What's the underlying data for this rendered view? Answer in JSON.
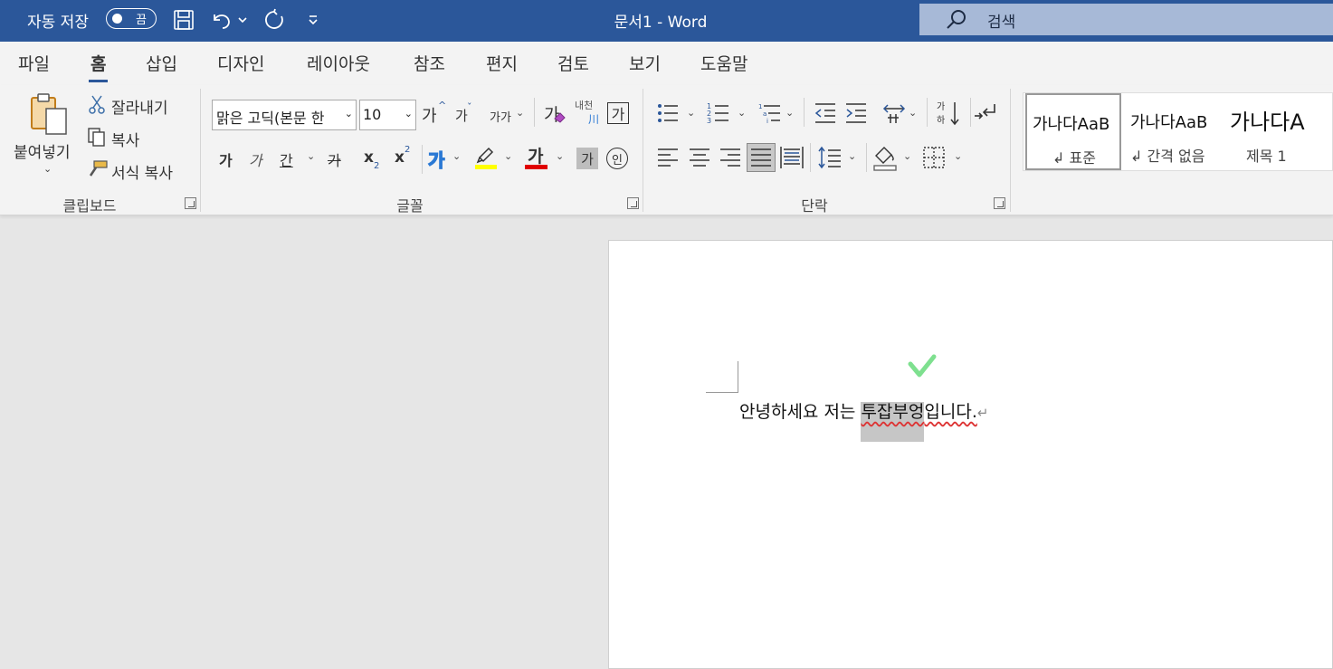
{
  "titlebar": {
    "autosave_label": "자동 저장",
    "autosave_state": "끔",
    "doc_title": "문서1  -  Word",
    "search_placeholder": "검색",
    "bg_color": "#2b579a"
  },
  "tabs": [
    {
      "label": "파일"
    },
    {
      "label": "홈",
      "active": true
    },
    {
      "label": "삽입"
    },
    {
      "label": "디자인"
    },
    {
      "label": "레이아웃"
    },
    {
      "label": "참조"
    },
    {
      "label": "편지"
    },
    {
      "label": "검토"
    },
    {
      "label": "보기"
    },
    {
      "label": "도움말"
    }
  ],
  "clipboard": {
    "paste_label": "붙여넣기",
    "cut_label": "잘라내기",
    "copy_label": "복사",
    "format_painter_label": "서식 복사",
    "group_label": "클립보드"
  },
  "font": {
    "font_name": "맑은 고딕(본문 한",
    "font_size": "10",
    "grow_label": "가",
    "shrink_label": "가",
    "case_label": "가가",
    "clear_format_label": "가",
    "phonetic_label_top": "내천",
    "phonetic_label_bottom": "川",
    "char_border_label": "가",
    "bold_label": "가",
    "italic_label": "가",
    "underline_label": "간",
    "strike_label": "가",
    "subscript_label": "x",
    "subscript_mark": "2",
    "superscript_label": "x",
    "superscript_mark": "2",
    "text_effect_label": "가",
    "font_color_label": "가",
    "shading_label": "가",
    "enclose_label": "인",
    "highlight_color": "#ffff00",
    "font_color": "#e00000",
    "group_label": "글꼴"
  },
  "paragraph": {
    "group_label": "단락"
  },
  "styles": [
    {
      "sample": "가나다AaB",
      "name": "↲ 표준",
      "selected": true
    },
    {
      "sample": "가나다AaB",
      "name": "↲ 간격 없음",
      "selected": false
    },
    {
      "sample": "가나다A",
      "name": "제목 1",
      "selected": false
    }
  ],
  "document": {
    "text_before": "안녕하세요 저는 ",
    "text_highlighted": "투잡부엉",
    "text_after": "입니다.",
    "para_mark": "↵"
  }
}
